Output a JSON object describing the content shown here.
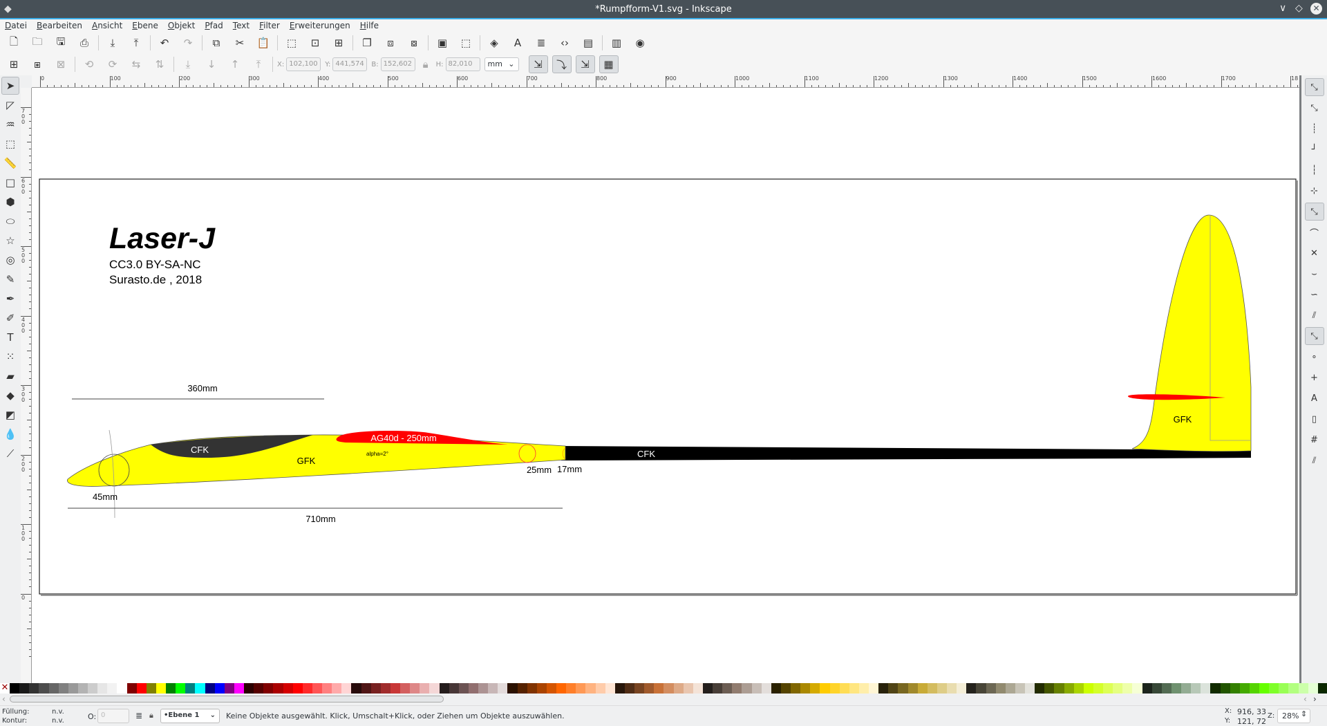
{
  "window": {
    "title": "*Rumpfform-V1.svg - Inkscape"
  },
  "menu": [
    "Datei",
    "Bearbeiten",
    "Ansicht",
    "Ebene",
    "Objekt",
    "Pfad",
    "Text",
    "Filter",
    "Erweiterungen",
    "Hilfe"
  ],
  "toolbar1": [
    {
      "icon": "new-document-icon",
      "g": "🗋"
    },
    {
      "icon": "open-icon",
      "g": "🗀"
    },
    {
      "icon": "save-icon",
      "g": "🖫"
    },
    {
      "icon": "print-icon",
      "g": "⎙"
    },
    "|",
    {
      "icon": "import-icon",
      "g": "⤓"
    },
    {
      "icon": "export-icon",
      "g": "⤒"
    },
    "|",
    {
      "icon": "undo-icon",
      "g": "↶"
    },
    {
      "icon": "redo-icon",
      "g": "↷",
      "dis": true
    },
    "|",
    {
      "icon": "copy-icon",
      "g": "⧉"
    },
    {
      "icon": "cut-icon",
      "g": "✂"
    },
    {
      "icon": "paste-icon",
      "g": "📋"
    },
    "|",
    {
      "icon": "zoom-selection-icon",
      "g": "⬚"
    },
    {
      "icon": "zoom-drawing-icon",
      "g": "⊡"
    },
    {
      "icon": "zoom-page-icon",
      "g": "⊞"
    },
    "|",
    {
      "icon": "duplicate-icon",
      "g": "❐"
    },
    {
      "icon": "clone-icon",
      "g": "⧈"
    },
    {
      "icon": "unlink-clone-icon",
      "g": "⧇"
    },
    "|",
    {
      "icon": "group-icon",
      "g": "▣"
    },
    {
      "icon": "ungroup-icon",
      "g": "⬚"
    },
    "|",
    {
      "icon": "fill-stroke-icon",
      "g": "◈"
    },
    {
      "icon": "text-font-icon",
      "g": "A"
    },
    {
      "icon": "layers-icon",
      "g": "≣"
    },
    {
      "icon": "xml-editor-icon",
      "g": "‹›"
    },
    {
      "icon": "align-distribute-icon",
      "g": "▤"
    },
    "|",
    {
      "icon": "document-properties-icon",
      "g": "▥"
    },
    {
      "icon": "preferences-icon",
      "g": "◉"
    }
  ],
  "toolbar2": {
    "icons": [
      {
        "icon": "select-all-icon",
        "g": "⊞"
      },
      {
        "icon": "select-all-layers-icon",
        "g": "⧆"
      },
      {
        "icon": "deselect-icon",
        "g": "⊠",
        "dis": true
      },
      "|",
      {
        "icon": "rotate-ccw-icon",
        "g": "⟲",
        "dis": true
      },
      {
        "icon": "rotate-cw-icon",
        "g": "⟳",
        "dis": true
      },
      {
        "icon": "flip-horizontal-icon",
        "g": "⇆",
        "dis": true
      },
      {
        "icon": "flip-vertical-icon",
        "g": "⇅",
        "dis": true
      },
      "|",
      {
        "icon": "lower-to-bottom-icon",
        "g": "⤓",
        "dis": true
      },
      {
        "icon": "lower-icon",
        "g": "↓",
        "dis": true
      },
      {
        "icon": "raise-icon",
        "g": "↑",
        "dis": true
      },
      {
        "icon": "raise-to-top-icon",
        "g": "⤒",
        "dis": true
      },
      "|"
    ],
    "x_label": "X:",
    "x": "102,100",
    "y_label": "Y:",
    "y": "441,574",
    "w_label": "B:",
    "w": "152,602",
    "h_label": "H:",
    "h": "82,010",
    "unit": "mm",
    "transform": [
      {
        "icon": "scale-stroke-icon",
        "g": "⇲"
      },
      {
        "icon": "scale-corners-icon",
        "g": "⤵"
      },
      {
        "icon": "transform-gradients-icon",
        "g": "⇲"
      },
      {
        "icon": "transform-patterns-icon",
        "g": "▦"
      }
    ]
  },
  "toolbox": [
    {
      "icon": "selector-tool-icon",
      "g": "➤",
      "pressed": true
    },
    {
      "icon": "node-tool-icon",
      "g": "◸"
    },
    {
      "icon": "tweak-tool-icon",
      "g": "♒"
    },
    {
      "icon": "zoom-tool-icon",
      "g": "⬚"
    },
    {
      "icon": "measure-tool-icon",
      "g": "📏"
    },
    {
      "icon": "rectangle-tool-icon",
      "g": "□"
    },
    {
      "icon": "3d-box-tool-icon",
      "g": "⬢"
    },
    {
      "icon": "ellipse-tool-icon",
      "g": "⬭"
    },
    {
      "icon": "star-tool-icon",
      "g": "☆"
    },
    {
      "icon": "spiral-tool-icon",
      "g": "◎"
    },
    {
      "icon": "pencil-tool-icon",
      "g": "✎"
    },
    {
      "icon": "pen-tool-icon",
      "g": "✒"
    },
    {
      "icon": "calligraphy-tool-icon",
      "g": "✐"
    },
    {
      "icon": "text-tool-icon",
      "g": "T"
    },
    {
      "icon": "spray-tool-icon",
      "g": "⁙"
    },
    {
      "icon": "eraser-tool-icon",
      "g": "▰"
    },
    {
      "icon": "paint-bucket-tool-icon",
      "g": "◆"
    },
    {
      "icon": "gradient-tool-icon",
      "g": "◩"
    },
    {
      "icon": "dropper-tool-icon",
      "g": "💧"
    },
    {
      "icon": "connector-tool-icon",
      "g": "⟋"
    }
  ],
  "snapbar": [
    {
      "icon": "snap-toggle-icon",
      "g": "⤡",
      "pressed": true
    },
    {
      "icon": "snap-bbox-icon",
      "g": "⤡"
    },
    {
      "icon": "snap-bbox-edges-icon",
      "g": "┊"
    },
    {
      "icon": "snap-bbox-corners-icon",
      "g": "┘"
    },
    {
      "icon": "snap-bbox-midpoints-icon",
      "g": "┆"
    },
    {
      "icon": "snap-bbox-centers-icon",
      "g": "⊹"
    },
    {
      "icon": "snap-nodes-icon",
      "g": "⤡",
      "pressed": true
    },
    {
      "icon": "snap-paths-icon",
      "g": "⌒"
    },
    {
      "icon": "snap-intersections-icon",
      "g": "✕"
    },
    {
      "icon": "snap-cusp-nodes-icon",
      "g": "⌣"
    },
    {
      "icon": "snap-smooth-nodes-icon",
      "g": "∽"
    },
    {
      "icon": "snap-midpoints-icon",
      "g": "⫽"
    },
    {
      "icon": "snap-others-icon",
      "g": "⤡",
      "pressed": true
    },
    {
      "icon": "snap-object-centers-icon",
      "g": "∘"
    },
    {
      "icon": "snap-rotation-centers-icon",
      "g": "+"
    },
    {
      "icon": "snap-text-baseline-icon",
      "g": "A"
    },
    {
      "icon": "snap-page-border-icon",
      "g": "▯"
    },
    {
      "icon": "snap-grid-icon",
      "g": "#"
    },
    {
      "icon": "snap-guides-icon",
      "g": "⫽"
    }
  ],
  "ruler_top": [
    "0",
    "100",
    "200",
    "300",
    "400",
    "500",
    "600",
    "700",
    "800",
    "900",
    "1000",
    "1100",
    "1200",
    "1300",
    "1400",
    "1500",
    "1600",
    "1700",
    "18"
  ],
  "ruler_left": [
    "700",
    "600",
    "500",
    "400",
    "300",
    "200",
    "100",
    "0"
  ],
  "drawing": {
    "title": "Laser-J",
    "license": "CC3.0 BY-SA-NC",
    "author": "Surasto.de , 2018",
    "dim_360": "360mm",
    "dim_710": "710mm",
    "dia_45": "45mm",
    "dia_25": "25mm",
    "dia_17": "17mm",
    "wing_label": "AG40d - 250mm",
    "alpha_label": "alpha=2°",
    "fuselage_cfk": "CFK",
    "fuselage_gfk": "GFK",
    "boom_cfk": "CFK",
    "fin_gfk": "GFK",
    "colors": {
      "yellow": "#ffff00",
      "red": "#ff0000",
      "dark": "#333333",
      "boom": "#000000"
    }
  },
  "palette": [
    "#000000",
    "#1a1a1a",
    "#333333",
    "#4d4d4d",
    "#666666",
    "#808080",
    "#999999",
    "#b3b3b3",
    "#cccccc",
    "#e6e6e6",
    "#f2f2f2",
    "#ffffff",
    "#800000",
    "#ff0000",
    "#808000",
    "#ffff00",
    "#008000",
    "#00ff00",
    "#008080",
    "#00ffff",
    "#000080",
    "#0000ff",
    "#800080",
    "#ff00ff",
    "#2b0000",
    "#550000",
    "#800000",
    "#aa0000",
    "#d40000",
    "#ff0000",
    "#ff2a2a",
    "#ff5555",
    "#ff8080",
    "#ffaaaa",
    "#ffd5d5",
    "#280b0b",
    "#501616",
    "#782121",
    "#a02c2c",
    "#c83737",
    "#d35f5f",
    "#de8787",
    "#e9afaf",
    "#f4d7d7",
    "#241c1c",
    "#483737",
    "#6c5353",
    "#916f6f",
    "#ac9393",
    "#c8b7b7",
    "#e3dbdb",
    "#2b1100",
    "#552200",
    "#803300",
    "#aa4400",
    "#d45500",
    "#ff6600",
    "#ff7f2a",
    "#ff9955",
    "#ffb380",
    "#ffccaa",
    "#ffe6d5",
    "#28170b",
    "#502d16",
    "#784421",
    "#a05a2c",
    "#c87137",
    "#d38d5f",
    "#deaa87",
    "#e9c6af",
    "#f4e3d7",
    "#241f1c",
    "#483e37",
    "#6c5d53",
    "#917c6f",
    "#ac9d93",
    "#c8beb7",
    "#e3dedb",
    "#2b2200",
    "#554400",
    "#806600",
    "#aa8800",
    "#d4aa00",
    "#ffcc00",
    "#ffd42a",
    "#ffdd55",
    "#ffe680",
    "#ffeeaa",
    "#fff6d5",
    "#28220b",
    "#504416",
    "#786721",
    "#a0892c",
    "#c8ab37",
    "#d3bc5f",
    "#decd87",
    "#e9ddaf",
    "#f4eed7",
    "#24221c",
    "#484537",
    "#6c6753",
    "#918a6f",
    "#aca793",
    "#c8c4b7",
    "#e3e2db",
    "#222b00",
    "#445500",
    "#668000",
    "#88aa00",
    "#aad400",
    "#ccff00",
    "#d4ff2a",
    "#ddff55",
    "#e5ff80",
    "#eeffaa",
    "#f6ffd5",
    "#1c241c",
    "#374837",
    "#536c53",
    "#6f916f",
    "#93ac93",
    "#b7c8b7",
    "#dbe3db",
    "#112b00",
    "#225500",
    "#338000",
    "#44aa00",
    "#55d400",
    "#66ff00",
    "#7fff2a",
    "#99ff55",
    "#b3ff80",
    "#ccffaa",
    "#e5ffd5",
    "#0b2800"
  ],
  "status": {
    "fill_label": "Füllung:",
    "fill_value": "n.v.",
    "stroke_label": "Kontur:",
    "stroke_value": "n.v.",
    "opacity_label": "O:",
    "opacity": "0",
    "layer": "•Ebene 1",
    "message": "Keine Objekte ausgewählt. Klick, Umschalt+Klick, oder Ziehen um Objekte auszuwählen.",
    "x_label": "X:",
    "x": "916, 33",
    "y_label": "Y:",
    "y": "121, 72",
    "zoom_label": "Z:",
    "zoom": "28%"
  }
}
